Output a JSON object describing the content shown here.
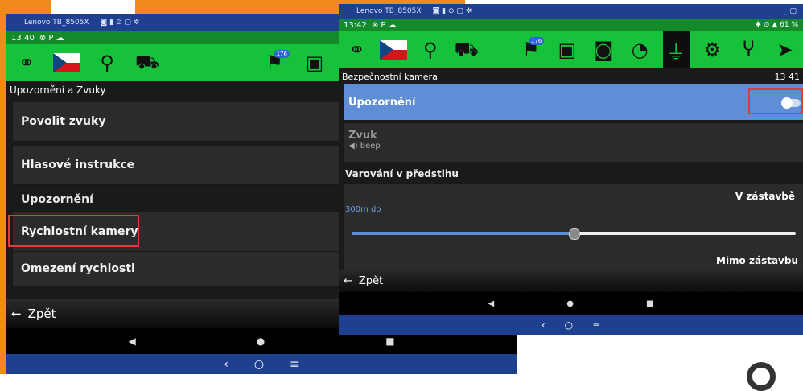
{
  "left": {
    "device_name": "Lenovo TB_8505X",
    "time": "13:40",
    "section_title": "Upozornění a Zvuky",
    "items": [
      {
        "label": "Povolit zvuky"
      },
      {
        "label": "Hlasové instrukce"
      },
      {
        "label": "Rychlostní kamery"
      },
      {
        "label": "Omezení rychlosti"
      }
    ],
    "group_label": "Upozornění",
    "back_label": "Zpět",
    "badge": "176"
  },
  "right": {
    "device_name": "Lenovo TB_8505X",
    "time": "13:42",
    "battery": "61 %",
    "section_title": "Bezpečnostní kamera",
    "header_value": "13 41",
    "alert_label": "Upozornění",
    "alert_enabled": false,
    "sound_label": "Zvuk",
    "sound_value": "beep",
    "advance_warning_label": "Varování v předstihu",
    "in_town_label": "V zástavbě",
    "in_town_value": "300m do",
    "in_town_fraction": 0.5,
    "out_town_label": "Mimo zástavbu",
    "back_label": "Zpět",
    "badge": "176"
  },
  "colors": {
    "accent_green": "#17c23b",
    "highlight_blue": "#5f8ed6",
    "android_blue": "#1f3f8f",
    "callout_red": "#e03a3a",
    "background_orange": "#f08a1c"
  }
}
